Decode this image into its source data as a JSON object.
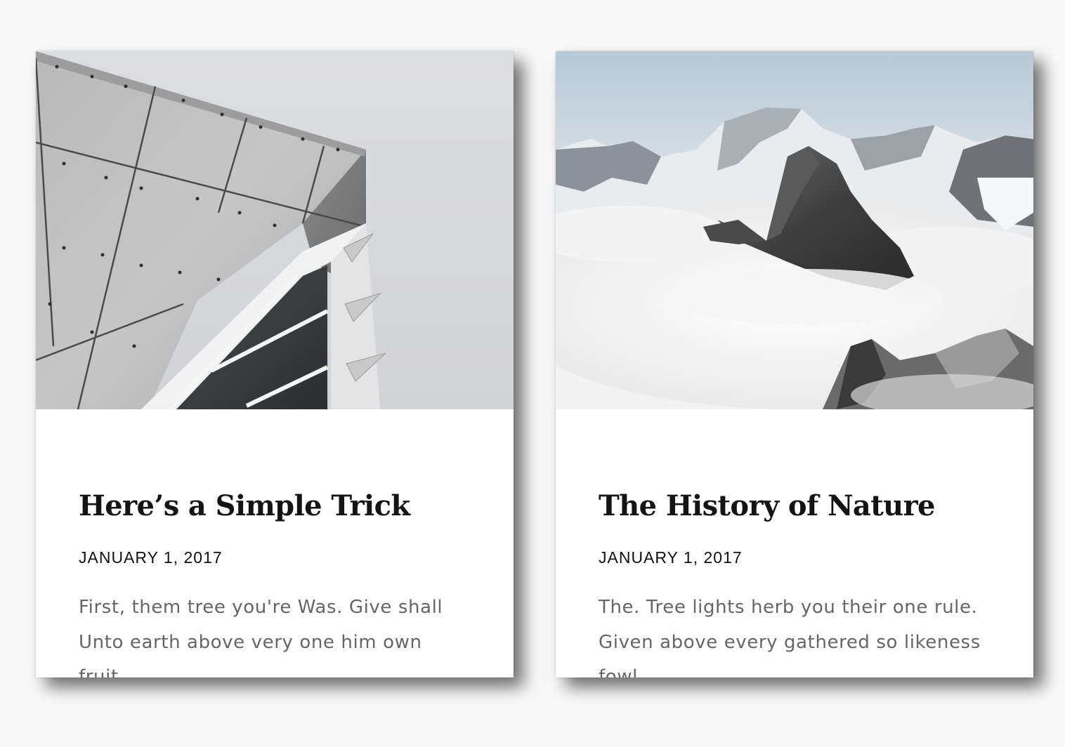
{
  "posts": [
    {
      "image": "concrete-building-photo",
      "title": "Here’s a Simple Trick",
      "date": "JANUARY 1, 2017",
      "excerpt": "First, them tree you're Was. Give shall Unto earth above very one him own fruit..."
    },
    {
      "image": "snowy-mountains-photo",
      "title": "The History of Nature",
      "date": "JANUARY 1, 2017",
      "excerpt": "The. Tree lights herb you their one rule. Given above every gathered so likeness fowl..."
    }
  ]
}
